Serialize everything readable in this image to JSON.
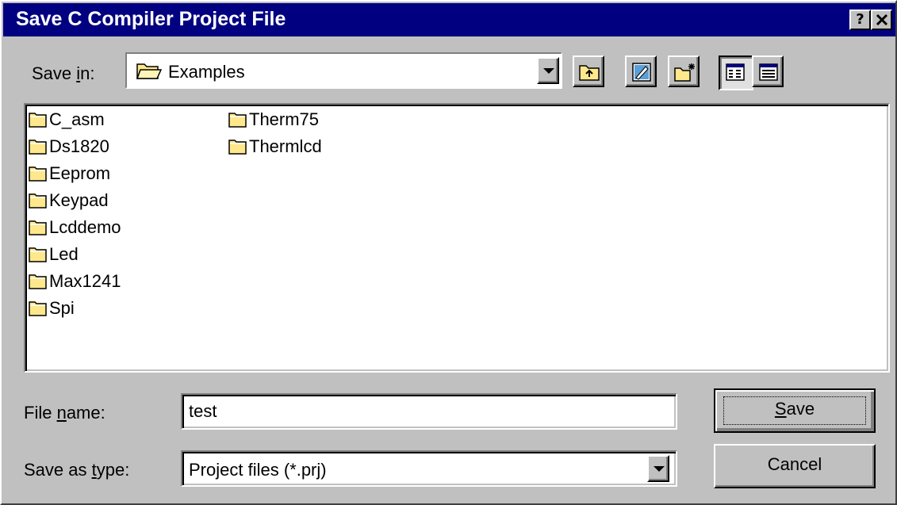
{
  "window": {
    "title": "Save C Compiler Project File",
    "help_button": "?",
    "close_button": "✕"
  },
  "save_in": {
    "label_pre": "Save ",
    "label_accel": "i",
    "label_post": "n:",
    "value": "Examples"
  },
  "toolbar": {
    "buttons": [
      {
        "name": "up-one-level",
        "icon": "folder-up-icon"
      },
      {
        "name": "desktop",
        "icon": "desktop-icon"
      },
      {
        "name": "create-new-folder",
        "icon": "new-folder-icon"
      },
      {
        "name": "list-view",
        "icon": "list-view-icon",
        "pressed": true
      },
      {
        "name": "details-view",
        "icon": "details-view-icon"
      }
    ]
  },
  "folders": [
    "C_asm",
    "Ds1820",
    "Eeprom",
    "Keypad",
    "Lcddemo",
    "Led",
    "Max1241",
    "Spi",
    "Therm75",
    "Thermlcd"
  ],
  "file_name": {
    "label_pre": "File ",
    "label_accel": "n",
    "label_post": "ame:",
    "value": "test"
  },
  "save_as_type": {
    "label_pre": "Save as ",
    "label_accel": "t",
    "label_post": "ype:",
    "value": "Project files (*.prj)"
  },
  "buttons": {
    "save_accel": "S",
    "save_rest": "ave",
    "cancel": "Cancel"
  },
  "colors": {
    "titlebar": "#000080",
    "face": "#c0c0c0",
    "folder": "#ffe88c"
  }
}
